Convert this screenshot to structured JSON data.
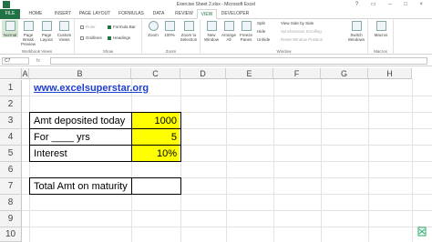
{
  "window": {
    "title": "Exercise Sheet 2.xlsx - Microsoft Excel",
    "controls": "? ▭ – □ ×"
  },
  "tabs": [
    "FILE",
    "HOME",
    "INSERT",
    "PAGE LAYOUT",
    "FORMULAS",
    "DATA",
    "REVIEW",
    "VIEW",
    "DEVELOPER"
  ],
  "active_tab": "VIEW",
  "ribbon": {
    "workbook_views": {
      "name": "Workbook Views",
      "normal": "Normal",
      "page_break": "Page Break Preview",
      "page_layout": "Page Layout",
      "custom_views": "Custom Views"
    },
    "show": {
      "name": "Show",
      "ruler": "Ruler",
      "formula_bar": "Formula Bar",
      "gridlines": "Gridlines",
      "headings": "Headings"
    },
    "zoom": {
      "name": "Zoom",
      "zoom": "Zoom",
      "hundred": "100%",
      "zoom_selection": "Zoom to Selection"
    },
    "window": {
      "name": "Window",
      "new_window": "New Window",
      "arrange_all": "Arrange All",
      "freeze_panes": "Freeze Panes",
      "split": "Split",
      "hide": "Hide",
      "unhide": "Unhide",
      "side_by_side": "View Side by Side",
      "sync_scroll": "Synchronous Scrolling",
      "reset_position": "Reset Window Position",
      "switch_windows": "Switch Windows"
    },
    "macros": {
      "name": "Macros",
      "macros": "Macros"
    }
  },
  "formula_bar": {
    "name_box": "C7",
    "fx": "fx",
    "value": ""
  },
  "columns": [
    "A",
    "B",
    "C",
    "D",
    "E",
    "F",
    "G",
    "H"
  ],
  "rows": [
    "1",
    "2",
    "3",
    "4",
    "5",
    "6",
    "7",
    "8",
    "9",
    "10"
  ],
  "cells": {
    "b2": "www.excelsuperstar.org",
    "b4": "Amt deposited today",
    "c4": "1000",
    "b5": "For ____ yrs",
    "c5": "5",
    "b6": "Interest",
    "c6": "10%",
    "b8": "Total Amt on maturity",
    "c8": ""
  },
  "colors": {
    "accent": "#217346",
    "highlight": "#ffff00",
    "link": "#1f3fd0"
  }
}
